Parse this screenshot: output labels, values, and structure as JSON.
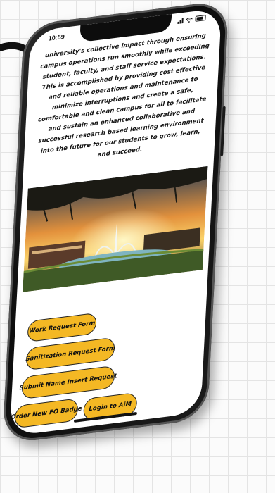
{
  "status_bar": {
    "time": "10:59"
  },
  "mission_text": "university's collective impact through ensuring campus operations run smoothly while exceeding student, faculty, and staff service expectations. This is accomplished by providing cost effective and reliable operations and maintenance to minimize interruptions and create a safe, comfortable and clean campus for all to facilitate and sustain an enhanced collaborative and successful research based learning environment into the future for our students to grow, learn, and succeed.",
  "buttons": {
    "work_request": "Work Request Form",
    "sanitization_request": "Sanitization Request Form",
    "name_insert_request": "Submit Name Insert Request",
    "fo_badge": "Order New FO Badge",
    "login_aim": "Login to AiM"
  },
  "colors": {
    "button_fill": "#f4b824",
    "button_border": "#222222",
    "phone_frame": "#111111",
    "background": "#fbfbfb"
  },
  "icons": [
    "signal-icon",
    "wifi-icon",
    "battery-icon",
    "arrow-icon"
  ]
}
